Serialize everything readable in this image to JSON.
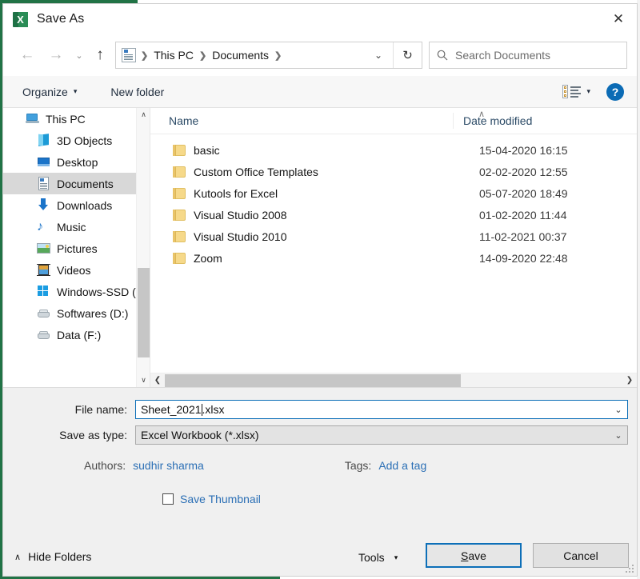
{
  "window": {
    "title": "Save As",
    "app_icon": "excel-icon",
    "close_label": "✕"
  },
  "nav": {
    "back": "←",
    "forward": "→",
    "history_caret": "⌄",
    "up": "↑",
    "address_dropdown": "⌄",
    "refresh": "↻",
    "breadcrumbs": [
      "This PC",
      "Documents"
    ],
    "separator": "❯"
  },
  "search": {
    "placeholder": "Search Documents",
    "icon": "search-icon"
  },
  "toolbar": {
    "organize": "Organize",
    "organize_caret": "▾",
    "new_folder": "New folder",
    "view_caret": "▾",
    "help": "?"
  },
  "sidebar": {
    "items": [
      {
        "label": "This PC",
        "icon": "pc-icon",
        "indent": false,
        "selected": false
      },
      {
        "label": "3D Objects",
        "icon": "3d-objects-icon",
        "indent": true,
        "selected": false
      },
      {
        "label": "Desktop",
        "icon": "desktop-icon",
        "indent": true,
        "selected": false
      },
      {
        "label": "Documents",
        "icon": "documents-icon",
        "indent": true,
        "selected": true
      },
      {
        "label": "Downloads",
        "icon": "downloads-icon",
        "indent": true,
        "selected": false
      },
      {
        "label": "Music",
        "icon": "music-icon",
        "indent": true,
        "selected": false
      },
      {
        "label": "Pictures",
        "icon": "pictures-icon",
        "indent": true,
        "selected": false
      },
      {
        "label": "Videos",
        "icon": "videos-icon",
        "indent": true,
        "selected": false
      },
      {
        "label": "Windows-SSD (C",
        "icon": "windows-drive-icon",
        "indent": true,
        "selected": false
      },
      {
        "label": "Softwares (D:)",
        "icon": "drive-icon",
        "indent": true,
        "selected": false
      },
      {
        "label": "Data (F:)",
        "icon": "drive-icon",
        "indent": true,
        "selected": false
      }
    ],
    "scroll_up": "∧",
    "scroll_down": "∨"
  },
  "filelist": {
    "columns": [
      "Name",
      "Date modified"
    ],
    "sort_indicator": "∧",
    "rows": [
      {
        "name": "basic",
        "date": "15-04-2020 16:15"
      },
      {
        "name": "Custom Office Templates",
        "date": "02-02-2020 12:55"
      },
      {
        "name": "Kutools for Excel",
        "date": "05-07-2020 18:49"
      },
      {
        "name": "Visual Studio 2008",
        "date": "01-02-2020 11:44"
      },
      {
        "name": "Visual Studio 2010",
        "date": "11-02-2021 00:37"
      },
      {
        "name": "Zoom",
        "date": "14-09-2020 22:48"
      }
    ],
    "hscroll_left": "❮",
    "hscroll_right": "❯"
  },
  "form": {
    "file_name_label": "File name:",
    "file_name_value_before_caret": "Sheet_2021",
    "file_name_value_after_caret": ".xlsx",
    "file_name_value": "Sheet_2021.xlsx",
    "save_type_label": "Save as type:",
    "save_type_value": "Excel Workbook (*.xlsx)",
    "dropdown_caret": "⌄",
    "authors_label": "Authors:",
    "authors_value": "sudhir sharma",
    "tags_label": "Tags:",
    "tags_value": "Add a tag",
    "save_thumbnail_label": "Save Thumbnail",
    "save_thumbnail_checked": false
  },
  "footer": {
    "hide_folders": "Hide Folders",
    "hide_folders_caret": "∧",
    "tools": "Tools",
    "tools_caret": "▾",
    "save": "Save",
    "save_mnemonic": "S",
    "cancel": "Cancel"
  },
  "colors": {
    "accent_blue": "#0d6fb8",
    "link_blue": "#2b6fb5",
    "excel_green": "#1e7145",
    "selection_gray": "#d8d8d8",
    "folder_yellow": "#f6d98a",
    "chrome_gray": "#f0f0f0"
  }
}
